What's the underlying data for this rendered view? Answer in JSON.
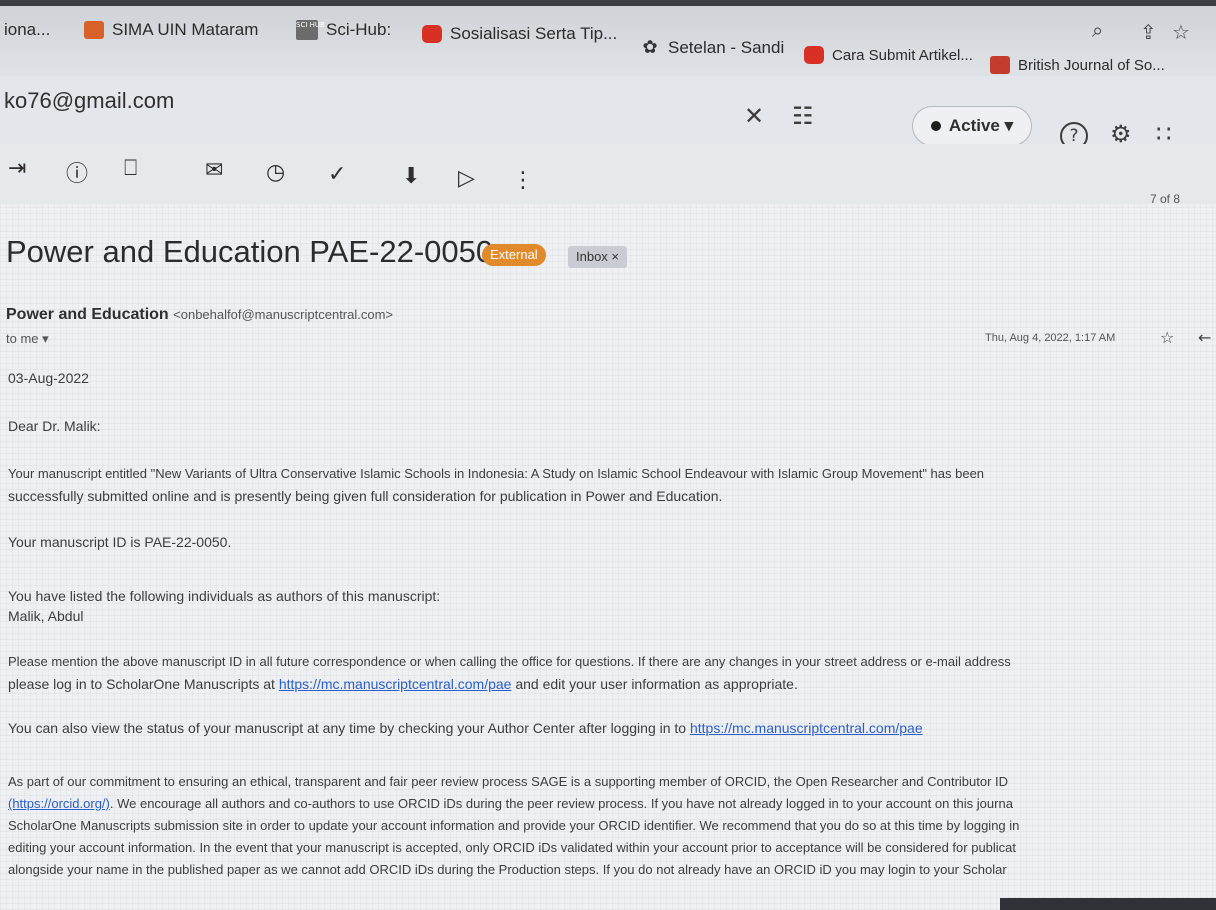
{
  "bookmarks": {
    "items": [
      {
        "label": "iona...",
        "icon": "none"
      },
      {
        "label": "SIMA UIN Mataram",
        "icon": "sima-icon"
      },
      {
        "label": "Sci-Hub:",
        "icon": "scihub-icon",
        "icon_text": "SCI HUB"
      },
      {
        "label": "Sosialisasi Serta Tip...",
        "icon": "youtube-icon"
      },
      {
        "label": "Setelan - Sandi",
        "icon": "gear-icon"
      },
      {
        "label": "Cara Submit Artikel...",
        "icon": "youtube-icon"
      },
      {
        "label": "British Journal of So...",
        "icon": "bjs-icon"
      }
    ],
    "zoom_icon": "⌕",
    "share_icon": "⇪",
    "star_icon": "☆"
  },
  "header": {
    "account": "ko76@gmail.com",
    "close_icon": "✕",
    "filter_icon": "☷",
    "status_label": "Active ▾",
    "help_icon": "?",
    "settings_icon": "⚙",
    "apps_icon": "∷"
  },
  "toolbar": {
    "icons": [
      "⇥",
      "ⓘ",
      "⎕",
      "✉",
      "◷",
      "✓",
      "⬇",
      "▷",
      "⋮"
    ],
    "count": "7 of 8"
  },
  "email": {
    "subject": "Power and Education PAE-22-0050",
    "badge_external": "External",
    "badge_inbox": "Inbox ×",
    "sender_name": "Power and Education",
    "sender_email": "<onbehalfof@manuscriptcentral.com>",
    "to_me": "to me ▾",
    "date": "Thu, Aug 4, 2022, 1:17 AM",
    "star_icon": "☆",
    "reply_icon": "←",
    "body": {
      "date_line": "03-Aug-2022",
      "greeting": "Dear Dr. Malik:",
      "p1_line1": "Your manuscript entitled \"New Variants of Ultra Conservative Islamic Schools in Indonesia:  A Study on Islamic School Endeavour with Islamic Group Movement\" has been",
      "p1_line2": "successfully submitted online and is presently being given full consideration for publication in Power and Education.",
      "p2": "Your manuscript ID is PAE-22-0050.",
      "p3_line1": "You have listed the following individuals as authors of this manuscript:",
      "p3_line2": "Malik, Abdul",
      "p4_line1": "Please mention the above manuscript ID in all future correspondence or when calling the office for questions. If there are any changes in your street address or e-mail address",
      "p4_line2_pre": "please log in to ScholarOne Manuscripts at ",
      "p4_link": "https://mc.manuscriptcentral.com/pae",
      "p4_line2_post": " and edit your user information as appropriate.",
      "p5_pre": "You can also view the status of your manuscript at any time by checking your Author Center after logging in to ",
      "p5_link": "https://mc.manuscriptcentral.com/pae",
      "p6_line1": "As part of our commitment to ensuring an ethical, transparent and fair peer review process SAGE is a supporting member of ORCID, the Open Researcher and Contributor ID",
      "p6_link": "(https://orcid.org/)",
      "p6_line2_post": ". We encourage all authors and co-authors to use ORCID iDs during the peer review process. If you have not already logged in to your account on this journa",
      "p6_line3": "ScholarOne Manuscripts submission site in order to update your account information and provide your ORCID identifier. We recommend that you do so at this time by logging in",
      "p6_line4": "editing your account information. In the event that your manuscript is accepted, only ORCID iDs validated within your account prior to acceptance will be considered for publicat",
      "p6_line5": "alongside your name in the published paper as we cannot add ORCID iDs during the Production steps. If you do not already have an ORCID iD you may login to your Scholar"
    }
  }
}
